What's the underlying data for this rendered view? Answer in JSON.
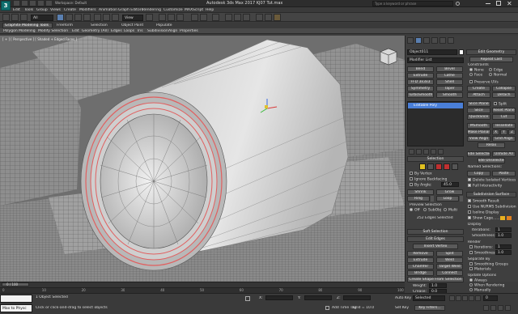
{
  "app": {
    "title": "Autodesk 3ds Max 2017    KJ07 Tut.max",
    "workspace": "Workspace: Default",
    "search_placeholder": "Type a keyword or phrase"
  },
  "menubar": {
    "items": [
      "Edit",
      "Tools",
      "Group",
      "Views",
      "Create",
      "Modifiers",
      "Animation",
      "Graph Editors",
      "Rendering",
      "Customize",
      "MAXScript",
      "Help"
    ]
  },
  "ribbon": {
    "tabs": [
      "Graphite Modeling Tools",
      "Freeform",
      "Selection",
      "Object Paint",
      "Populate"
    ],
    "panels": [
      "Polygon Modeling",
      "Modify Selection",
      "Edit",
      "Geometry (All)",
      "Edges",
      "Loops",
      "Tris",
      "Subdivision",
      "Align",
      "Properties"
    ]
  },
  "viewport": {
    "label": "[ + ] [ Perspective ] [ Shaded + Edged Faces ]"
  },
  "cmd": {
    "object_name": "Object011",
    "modifier_list": "Modifier List",
    "mod_buttons": [
      "Bend",
      "Bevel",
      "Extrude",
      "Lathe",
      "FFD 3x3x3",
      "Shell",
      "Symmetry",
      "Taper",
      "TurboSmooth",
      "Smooth"
    ],
    "stack_item": "Editable Poly"
  },
  "selection": {
    "title": "Selection",
    "by_vertex": "By Vertex",
    "ignore_backfacing": "Ignore Backfacing",
    "by_angle": "By Angle:",
    "angle_value": "45.0",
    "shrink": "Shrink",
    "grow": "Grow",
    "ring": "Ring",
    "loop": "Loop",
    "preview_title": "Preview Selection",
    "off": "Off",
    "subobj": "SubObj",
    "multi": "Multi",
    "status": "252 Edges Selected"
  },
  "soft": {
    "title": "Soft Selection"
  },
  "editedges": {
    "title": "Edit Edges",
    "insert_vertex": "Insert Vertex",
    "remove": "Remove",
    "split": "Split",
    "extrude": "Extrude",
    "weld": "Weld",
    "chamfer": "Chamfer",
    "target_weld": "Target Weld",
    "bridge": "Bridge",
    "connect": "Connect",
    "create_shape": "Create Shape From Selection",
    "weight": "Weight:",
    "weight_val": "1.0",
    "crease": "Crease:",
    "crease_val": "0.0"
  },
  "editgeom": {
    "title": "Edit Geometry",
    "repeat_last": "Repeat Last",
    "constraints": "Constraints",
    "none": "None",
    "edge": "Edge",
    "face": "Face",
    "normal": "Normal",
    "preserve_uvs": "Preserve UVs",
    "create": "Create",
    "collapse": "Collapse",
    "attach": "Attach",
    "detach": "Detach",
    "slice_plane": "Slice Plane",
    "split": "Split",
    "slice": "Slice",
    "reset_plane": "Reset Plane",
    "quickslice": "QuickSlice",
    "cut": "Cut",
    "msmooth": "MSmooth",
    "tessellate": "Tessellate",
    "make_planar": "Make Planar",
    "x": "X",
    "y": "Y",
    "z": "Z",
    "view_align": "View Align",
    "grid_align": "Grid Align",
    "relax": "Relax",
    "hide_selected": "Hide Selected",
    "unhide_all": "Unhide All",
    "hide_unselected": "Hide Unselected",
    "named_selections": "Named Selections:",
    "copy": "Copy",
    "paste": "Paste",
    "delete_isolated": "Delete Isolated Vertices",
    "full_interactivity": "Full Interactivity"
  },
  "subdiv": {
    "title": "Subdivision Surface",
    "smooth_result": "Smooth Result",
    "use_nurms": "Use NURMS Subdivision",
    "isoline": "Isoline Display",
    "show_cage": "Show Cage......",
    "display": "Display",
    "iterations": "Iterations:",
    "iter_val": "1",
    "smoothness": "Smoothness:",
    "smooth_val": "1.0",
    "render": "Render",
    "separate_by": "Separate By",
    "smoothing_groups": "Smoothing Groups",
    "materials": "Materials",
    "update_options": "Update Options",
    "always": "Always",
    "when_rendering": "When Rendering",
    "manually": "Manually"
  },
  "timeline": {
    "frame": "0 / 100",
    "ticks": [
      "0",
      "10",
      "20",
      "30",
      "40",
      "50",
      "60",
      "70",
      "80",
      "90",
      "100"
    ]
  },
  "status": {
    "maxscript": "Max to Physc",
    "selected": "1 Object Selected",
    "prompt": "Click or click-and-drag to select objects",
    "x_label": "X:",
    "y_label": "Y:",
    "z_label": "Z:",
    "grid": "Grid = 10.0",
    "autokey": "Auto Key",
    "selected_btn": "Selected",
    "setkey": "Set Key",
    "keyfilters": "Key Filters...",
    "add_time_tag": "Add Time Tag"
  },
  "colors": {
    "accent": "#4a7fd8",
    "selection_red": "#e05a5a",
    "ui_bg": "#3c3c3c"
  }
}
